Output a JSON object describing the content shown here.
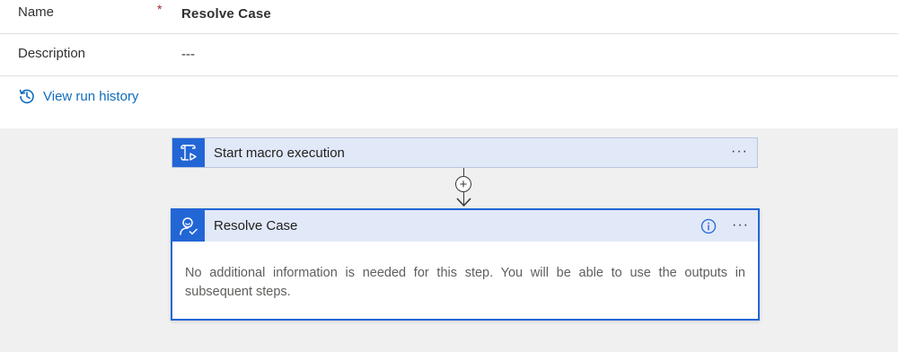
{
  "properties": {
    "name_label": "Name",
    "name_required": "*",
    "name_value": "Resolve Case",
    "description_label": "Description",
    "description_value": "---",
    "run_history_link": "View run history"
  },
  "flow": {
    "trigger": {
      "title": "Start macro execution",
      "more": "···",
      "icon": "script-play-icon"
    },
    "add_step": "+",
    "action": {
      "title": "Resolve Case",
      "more": "···",
      "icon": "person-check-icon",
      "body": "No additional information is needed for this step. You will be able to use the outputs in subsequent steps."
    }
  },
  "colors": {
    "accent": "#2266d6",
    "link": "#0f6cbd",
    "card_header": "#e1e8f8",
    "canvas": "#f0f0f0",
    "required": "#a4262c"
  }
}
